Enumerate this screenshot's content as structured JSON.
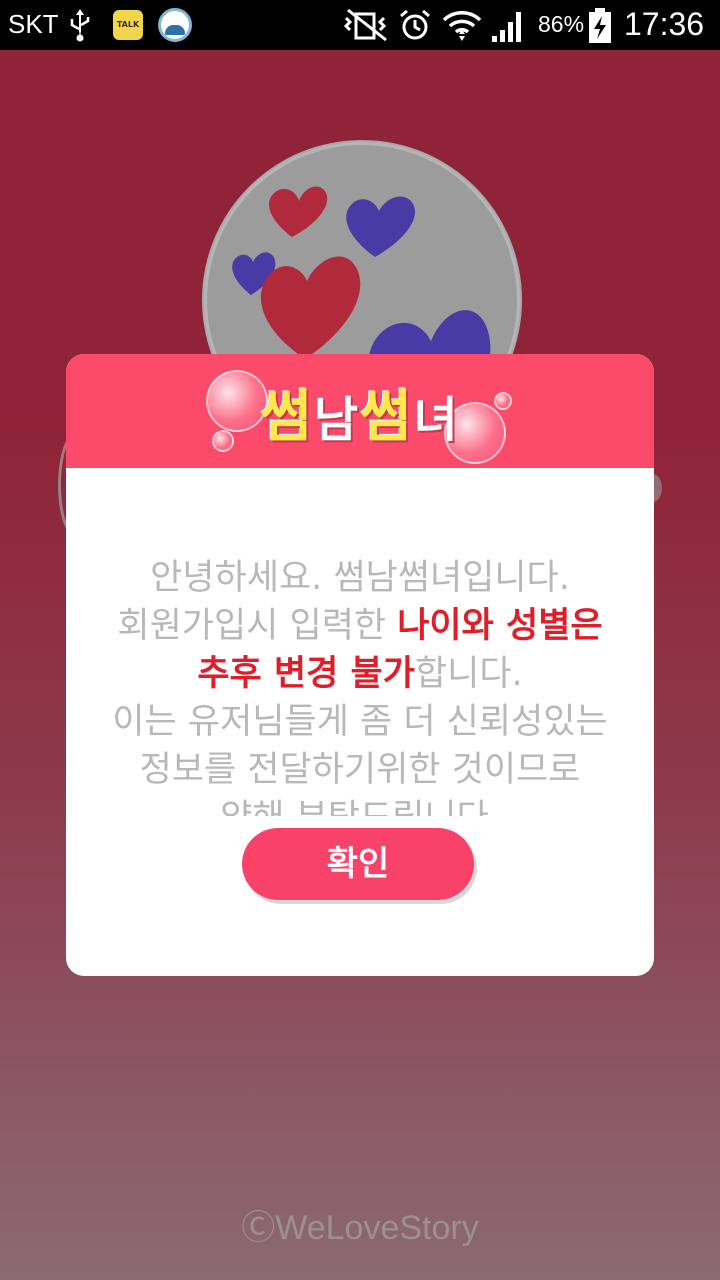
{
  "status_bar": {
    "carrier": "SKT",
    "talk_icon_text": "TALK",
    "battery_percent": "86%",
    "time": "17:36"
  },
  "dialog": {
    "title_parts": [
      "썸",
      "남",
      "썸",
      "녀"
    ],
    "message": {
      "line1": "안녕하세요. 썸남썸녀입니다.",
      "line2_normal": "회원가입시 입력한 ",
      "line2_red": "나이와 성별은",
      "line3_red": "추후 변경 불가",
      "line3_normal": "합니다.",
      "line4": "이는 유저님들게 좀 더 신뢰성있는",
      "line5": "정보를 전달하기위한 것이므로",
      "line6": "양해 부탁드립니다."
    },
    "confirm_label": "확인"
  },
  "footer": {
    "copyright": "ⒸWeLoveStory"
  },
  "colors": {
    "header": "#fb4a6a",
    "button": "#f8426a",
    "highlight": "#e01e2a",
    "heart_red": "#b02a3c",
    "heart_purple": "#4a3aa6"
  }
}
